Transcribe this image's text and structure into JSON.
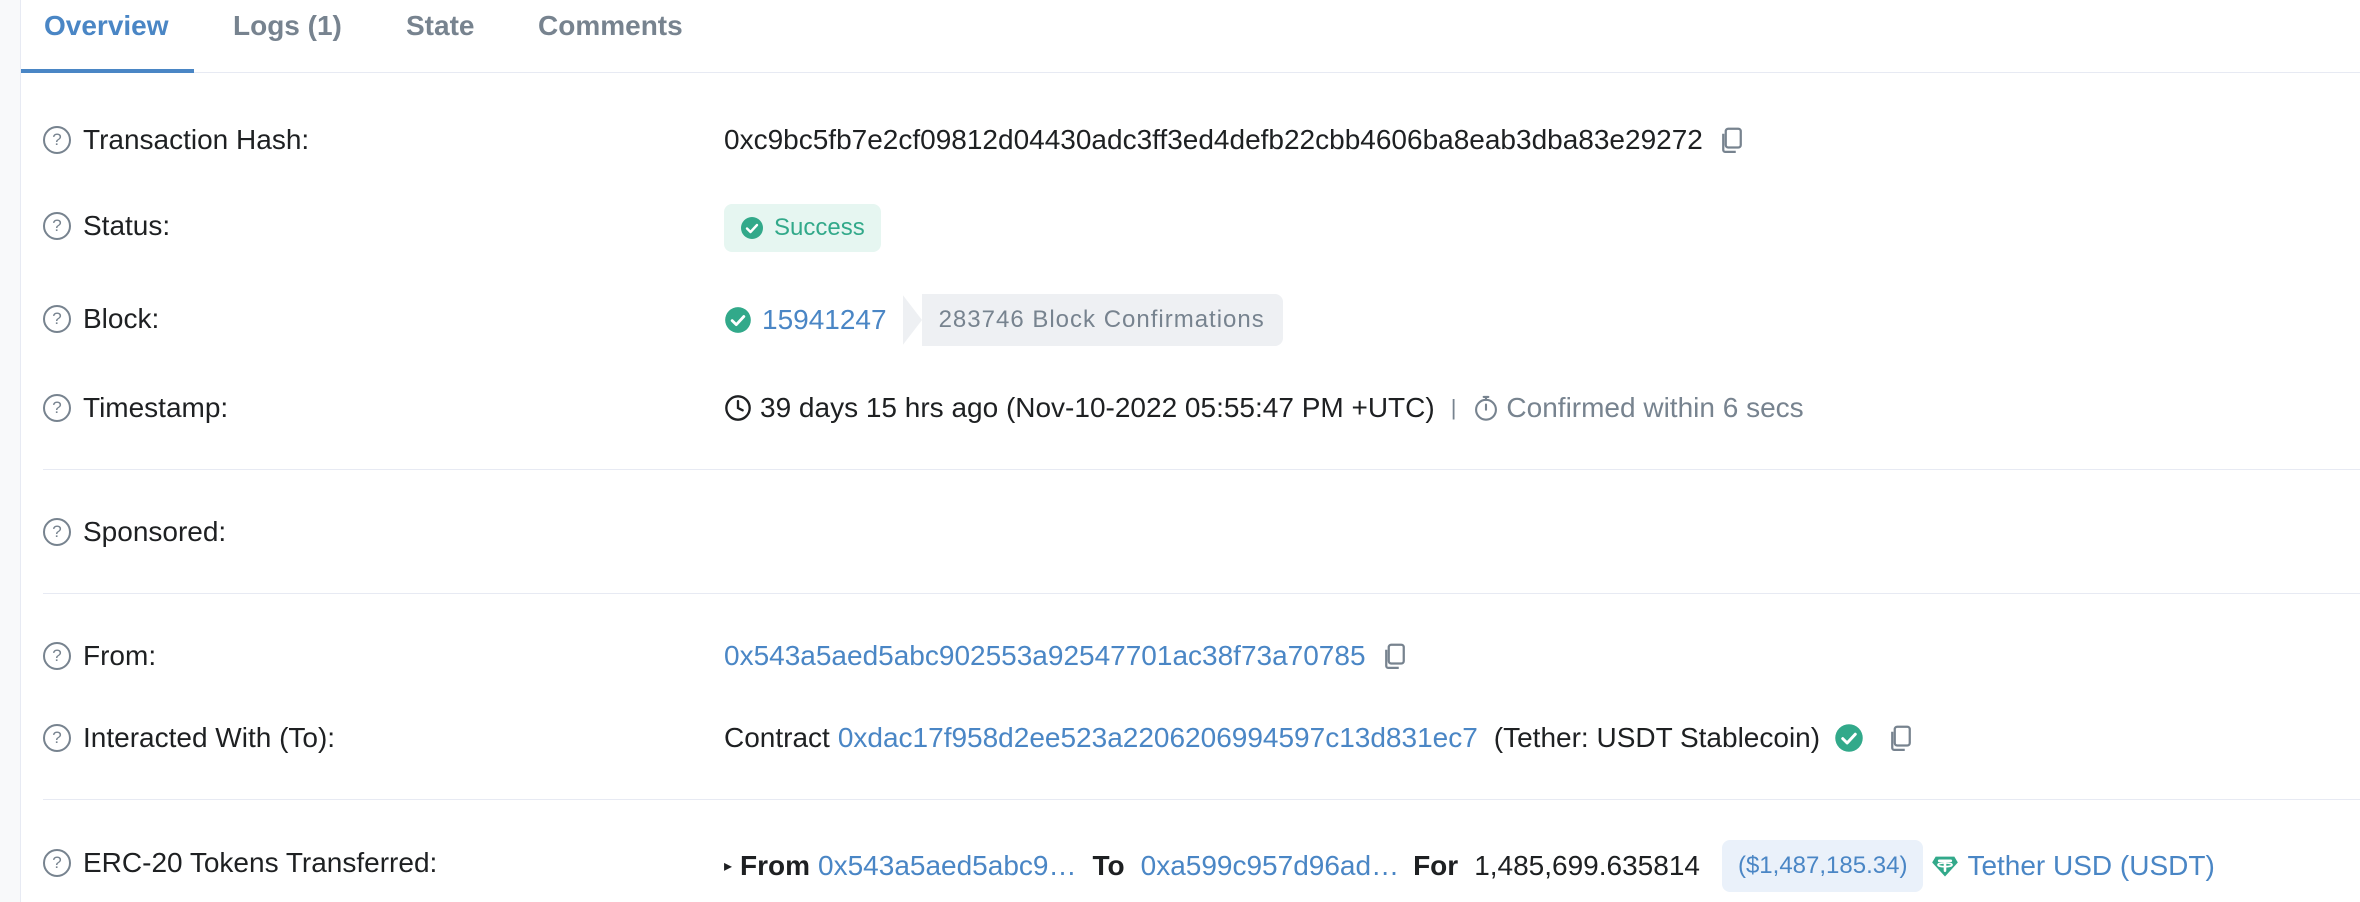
{
  "tabs": [
    {
      "label": "Overview",
      "active": true
    },
    {
      "label": "Logs (1)"
    },
    {
      "label": "State"
    },
    {
      "label": "Comments"
    }
  ],
  "rows": {
    "tx_hash": {
      "label": "Transaction Hash:",
      "value": "0xc9bc5fb7e2cf09812d04430adc3ff3ed4defb22cbb4606ba8eab3dba83e29272"
    },
    "status": {
      "label": "Status:",
      "value": "Success"
    },
    "block": {
      "label": "Block:",
      "number": "15941247",
      "confirmations": "283746 Block Confirmations"
    },
    "timestamp": {
      "label": "Timestamp:",
      "value": "39 days 15 hrs ago (Nov-10-2022 05:55:47 PM +UTC)",
      "separator": "|",
      "confirmed": "Confirmed within 6 secs"
    },
    "sponsored": {
      "label": "Sponsored:"
    },
    "from": {
      "label": "From:",
      "address": "0x543a5aed5abc902553a92547701ac38f73a70785"
    },
    "to": {
      "label": "Interacted With (To):",
      "prefix": "Contract",
      "address": "0xdac17f958d2ee523a2206206994597c13d831ec7",
      "name": "(Tether: USDT Stablecoin)"
    },
    "erc20": {
      "label": "ERC-20 Tokens Transferred:",
      "from_label": "From",
      "from_address": "0x543a5aed5abc9…",
      "to_label": "To",
      "to_address": "0xa599c957d96ad…",
      "for_label": "For",
      "amount": "1,485,699.635814",
      "usd_value": "($1,487,185.34)",
      "token": "Tether USD (USDT)"
    }
  },
  "colors": {
    "accent": "#4a86c5",
    "success": "#32a98a",
    "muted": "#77838f"
  }
}
